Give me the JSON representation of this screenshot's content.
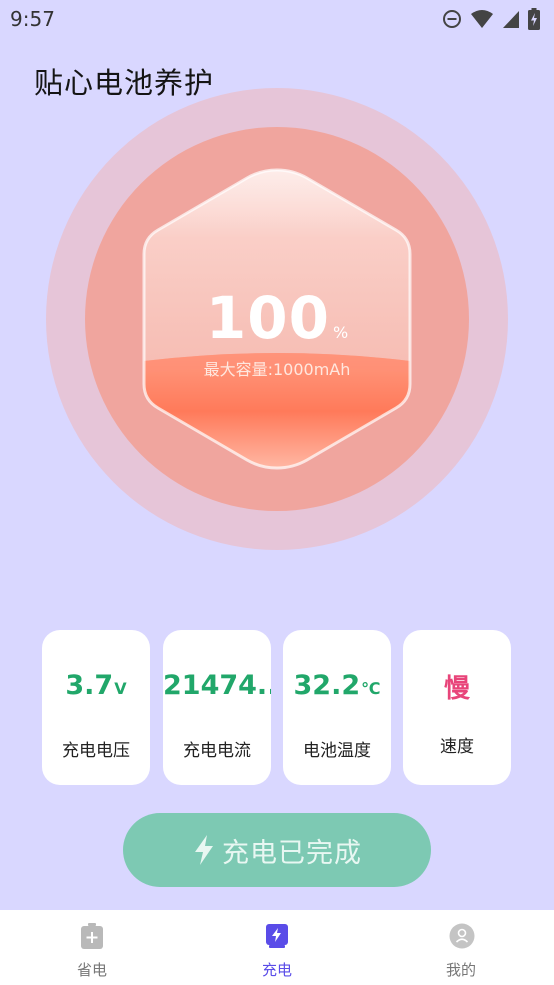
{
  "status_bar": {
    "time": "9:57",
    "icons": [
      "do-not-disturb-icon",
      "wifi-icon",
      "signal-icon",
      "battery-charging-icon"
    ]
  },
  "page": {
    "title": "贴心电池养护"
  },
  "battery": {
    "percent": "100",
    "percent_unit": "%",
    "capacity_text": "最大容量:1000mAh",
    "level_fraction": 1.0
  },
  "stats": [
    {
      "value": "3.7",
      "unit": "V",
      "label": "充电电压"
    },
    {
      "value": "21474...",
      "unit": "",
      "label": "充电电流"
    },
    {
      "value": "32.2",
      "unit": "℃",
      "label": "电池温度"
    },
    {
      "value": "慢",
      "unit": "",
      "label": "速度"
    }
  ],
  "charge_button": {
    "label": "充电已完成",
    "icon": "lightning-icon"
  },
  "bottom_nav": {
    "items": [
      {
        "label": "省电",
        "icon": "battery-plus-icon",
        "active": false
      },
      {
        "label": "充电",
        "icon": "charging-battery-icon",
        "active": true
      },
      {
        "label": "我的",
        "icon": "profile-icon",
        "active": false
      }
    ]
  },
  "colors": {
    "background": "#d9d7ff",
    "ring_outer": "#e6c5d8",
    "ring_inner": "#f0a59e",
    "value_green": "#21a76a",
    "value_pink": "#e8457a",
    "button": "#7dc9b3",
    "nav_active": "#5a4ce8"
  }
}
